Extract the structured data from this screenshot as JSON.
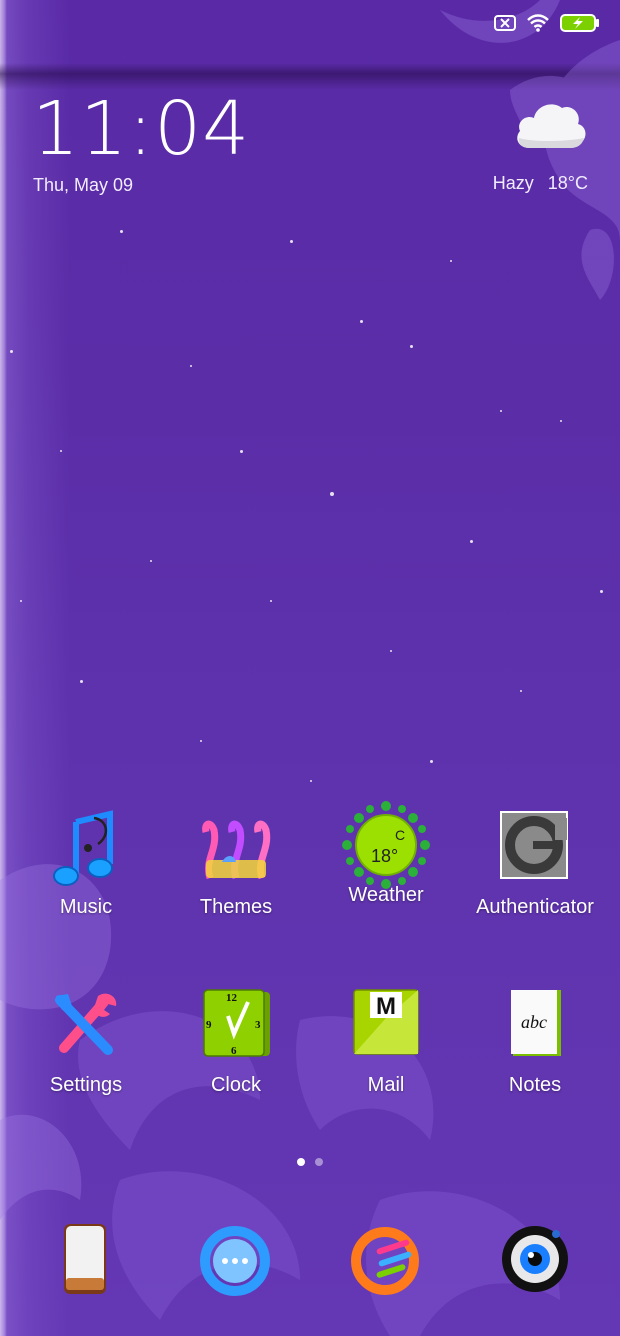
{
  "lockscreen": {
    "time": "11:04",
    "date": "Thu, May 09"
  },
  "weather": {
    "condition": "Hazy",
    "temperature": "18°C",
    "icon": "cloud-icon"
  },
  "status_icons": [
    "sim-error-icon",
    "wifi-icon",
    "battery-charging-icon"
  ],
  "apps": [
    {
      "label": "Music",
      "icon": "music-notes-icon"
    },
    {
      "label": "Themes",
      "icon": "themes-icon"
    },
    {
      "label": "Weather",
      "icon": "weather-sun-icon",
      "icon_text_top": "C",
      "icon_text_bottom": "18°"
    },
    {
      "label": "Authenticator",
      "icon": "authenticator-icon"
    },
    {
      "label": "Settings",
      "icon": "tools-icon"
    },
    {
      "label": "Clock",
      "icon": "clock-icon",
      "icon_numbers": [
        "12",
        "3",
        "6",
        "9"
      ]
    },
    {
      "label": "Mail",
      "icon": "mail-icon",
      "icon_letter": "M"
    },
    {
      "label": "Notes",
      "icon": "notes-icon",
      "icon_text": "abc"
    }
  ],
  "page_indicator": {
    "pages": 2,
    "current": 1
  },
  "dock": [
    "phone-icon",
    "messages-icon",
    "browser-icon",
    "camera-icon"
  ],
  "colors": {
    "wallpaper": "#5b2ea8",
    "battery_fill": "#7dd000",
    "weather_icon_green": "#9be000"
  }
}
